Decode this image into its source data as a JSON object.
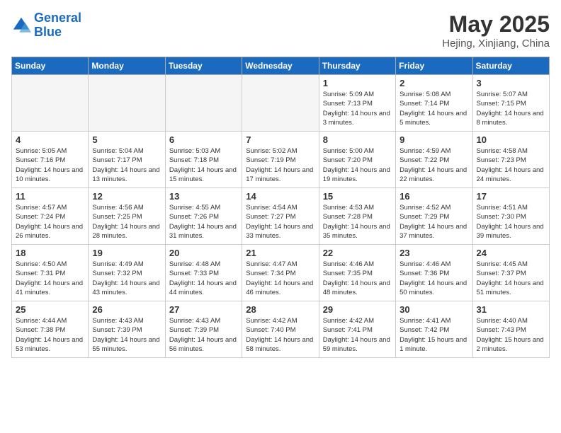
{
  "header": {
    "logo_line1": "General",
    "logo_line2": "Blue",
    "month_year": "May 2025",
    "location": "Hejing, Xinjiang, China"
  },
  "weekdays": [
    "Sunday",
    "Monday",
    "Tuesday",
    "Wednesday",
    "Thursday",
    "Friday",
    "Saturday"
  ],
  "weeks": [
    [
      {
        "day": "",
        "empty": true
      },
      {
        "day": "",
        "empty": true
      },
      {
        "day": "",
        "empty": true
      },
      {
        "day": "",
        "empty": true
      },
      {
        "day": "1",
        "sunrise": "5:09 AM",
        "sunset": "7:13 PM",
        "daylight": "14 hours and 3 minutes."
      },
      {
        "day": "2",
        "sunrise": "5:08 AM",
        "sunset": "7:14 PM",
        "daylight": "14 hours and 5 minutes."
      },
      {
        "day": "3",
        "sunrise": "5:07 AM",
        "sunset": "7:15 PM",
        "daylight": "14 hours and 8 minutes."
      }
    ],
    [
      {
        "day": "4",
        "sunrise": "5:05 AM",
        "sunset": "7:16 PM",
        "daylight": "14 hours and 10 minutes."
      },
      {
        "day": "5",
        "sunrise": "5:04 AM",
        "sunset": "7:17 PM",
        "daylight": "14 hours and 13 minutes."
      },
      {
        "day": "6",
        "sunrise": "5:03 AM",
        "sunset": "7:18 PM",
        "daylight": "14 hours and 15 minutes."
      },
      {
        "day": "7",
        "sunrise": "5:02 AM",
        "sunset": "7:19 PM",
        "daylight": "14 hours and 17 minutes."
      },
      {
        "day": "8",
        "sunrise": "5:00 AM",
        "sunset": "7:20 PM",
        "daylight": "14 hours and 19 minutes."
      },
      {
        "day": "9",
        "sunrise": "4:59 AM",
        "sunset": "7:22 PM",
        "daylight": "14 hours and 22 minutes."
      },
      {
        "day": "10",
        "sunrise": "4:58 AM",
        "sunset": "7:23 PM",
        "daylight": "14 hours and 24 minutes."
      }
    ],
    [
      {
        "day": "11",
        "sunrise": "4:57 AM",
        "sunset": "7:24 PM",
        "daylight": "14 hours and 26 minutes."
      },
      {
        "day": "12",
        "sunrise": "4:56 AM",
        "sunset": "7:25 PM",
        "daylight": "14 hours and 28 minutes."
      },
      {
        "day": "13",
        "sunrise": "4:55 AM",
        "sunset": "7:26 PM",
        "daylight": "14 hours and 31 minutes."
      },
      {
        "day": "14",
        "sunrise": "4:54 AM",
        "sunset": "7:27 PM",
        "daylight": "14 hours and 33 minutes."
      },
      {
        "day": "15",
        "sunrise": "4:53 AM",
        "sunset": "7:28 PM",
        "daylight": "14 hours and 35 minutes."
      },
      {
        "day": "16",
        "sunrise": "4:52 AM",
        "sunset": "7:29 PM",
        "daylight": "14 hours and 37 minutes."
      },
      {
        "day": "17",
        "sunrise": "4:51 AM",
        "sunset": "7:30 PM",
        "daylight": "14 hours and 39 minutes."
      }
    ],
    [
      {
        "day": "18",
        "sunrise": "4:50 AM",
        "sunset": "7:31 PM",
        "daylight": "14 hours and 41 minutes."
      },
      {
        "day": "19",
        "sunrise": "4:49 AM",
        "sunset": "7:32 PM",
        "daylight": "14 hours and 43 minutes."
      },
      {
        "day": "20",
        "sunrise": "4:48 AM",
        "sunset": "7:33 PM",
        "daylight": "14 hours and 44 minutes."
      },
      {
        "day": "21",
        "sunrise": "4:47 AM",
        "sunset": "7:34 PM",
        "daylight": "14 hours and 46 minutes."
      },
      {
        "day": "22",
        "sunrise": "4:46 AM",
        "sunset": "7:35 PM",
        "daylight": "14 hours and 48 minutes."
      },
      {
        "day": "23",
        "sunrise": "4:46 AM",
        "sunset": "7:36 PM",
        "daylight": "14 hours and 50 minutes."
      },
      {
        "day": "24",
        "sunrise": "4:45 AM",
        "sunset": "7:37 PM",
        "daylight": "14 hours and 51 minutes."
      }
    ],
    [
      {
        "day": "25",
        "sunrise": "4:44 AM",
        "sunset": "7:38 PM",
        "daylight": "14 hours and 53 minutes."
      },
      {
        "day": "26",
        "sunrise": "4:43 AM",
        "sunset": "7:39 PM",
        "daylight": "14 hours and 55 minutes."
      },
      {
        "day": "27",
        "sunrise": "4:43 AM",
        "sunset": "7:39 PM",
        "daylight": "14 hours and 56 minutes."
      },
      {
        "day": "28",
        "sunrise": "4:42 AM",
        "sunset": "7:40 PM",
        "daylight": "14 hours and 58 minutes."
      },
      {
        "day": "29",
        "sunrise": "4:42 AM",
        "sunset": "7:41 PM",
        "daylight": "14 hours and 59 minutes."
      },
      {
        "day": "30",
        "sunrise": "4:41 AM",
        "sunset": "7:42 PM",
        "daylight": "15 hours and 1 minute."
      },
      {
        "day": "31",
        "sunrise": "4:40 AM",
        "sunset": "7:43 PM",
        "daylight": "15 hours and 2 minutes."
      }
    ]
  ],
  "labels": {
    "sunrise": "Sunrise:",
    "sunset": "Sunset:",
    "daylight": "Daylight:"
  }
}
